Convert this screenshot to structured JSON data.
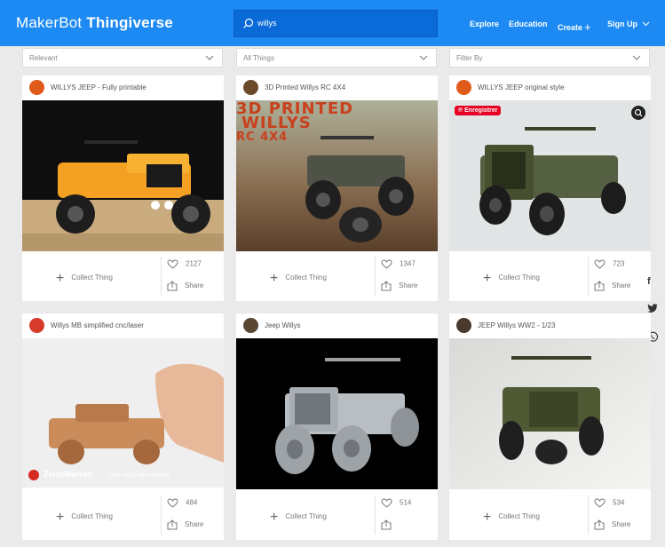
{
  "header": {
    "logo_brand": "MakerBot",
    "logo_product": "Thingiverse",
    "search_value": "willys",
    "nav": [
      "Explore",
      "Education",
      "Create",
      "Sign Up"
    ],
    "colors": {
      "bar": "#1c8af2",
      "search": "#0a6ad8"
    }
  },
  "filters": [
    "Relevant",
    "All Things",
    "Filter By"
  ],
  "card_actions": {
    "collect_label": "Collect Thing",
    "share_label": "Share"
  },
  "cards": [
    {
      "title": "WILLYS JEEP - Fully printable",
      "likes": "2127",
      "avatar_color": "#e05a1a"
    },
    {
      "title": "3D Printed Willys RC 4X4",
      "likes": "1347",
      "avatar_color": "#6b4a2b",
      "overlay_text": [
        "3D PRINTED",
        "WILLYS",
        "RC 4X4"
      ]
    },
    {
      "title": "WILLYS JEEP original style",
      "likes": "723",
      "avatar_color": "#e05a1a",
      "badge": "Enregistrer"
    },
    {
      "title": "Willys MB simplified cnc/laser",
      "likes": "484",
      "avatar_color": "#d63a2a",
      "watermark": "ZenziWerken",
      "caption": "1944 Willys MB simplified"
    },
    {
      "title": "Jeep Willys",
      "likes": "514",
      "avatar_color": "#5a4632"
    },
    {
      "title": "JEEP Willys WW2 - 1/23",
      "likes": "534",
      "avatar_color": "#4a3a2e"
    }
  ],
  "social": {
    "facebook": "f"
  }
}
